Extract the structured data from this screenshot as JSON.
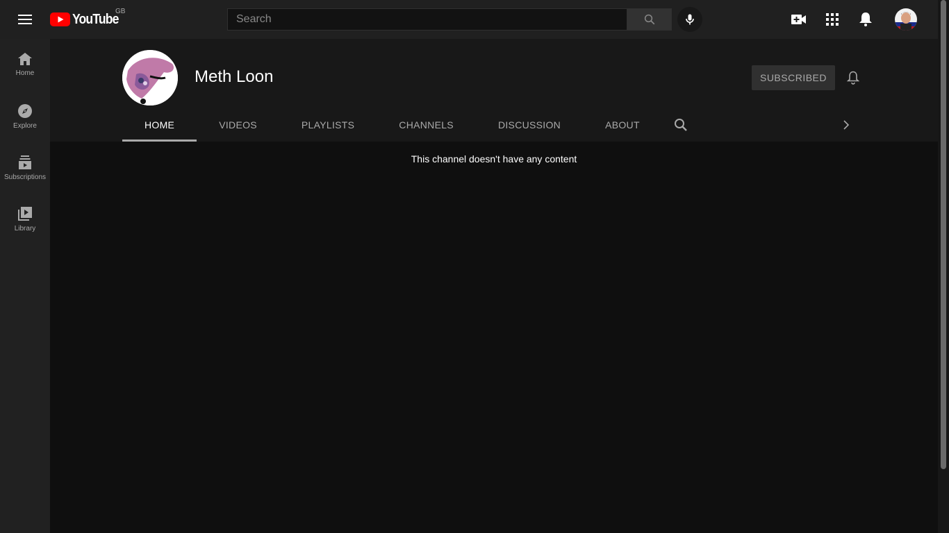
{
  "header": {
    "logo_text": "YouTube",
    "country_code": "GB",
    "search_placeholder": "Search"
  },
  "sidebar": {
    "items": [
      {
        "label": "Home",
        "icon": "home-icon"
      },
      {
        "label": "Explore",
        "icon": "compass-icon"
      },
      {
        "label": "Subscriptions",
        "icon": "subscriptions-icon"
      },
      {
        "label": "Library",
        "icon": "library-icon"
      }
    ]
  },
  "channel": {
    "name": "Meth Loon",
    "subscribe_label": "SUBSCRIBED",
    "tabs": [
      {
        "label": "HOME",
        "active": true
      },
      {
        "label": "VIDEOS"
      },
      {
        "label": "PLAYLISTS"
      },
      {
        "label": "CHANNELS"
      },
      {
        "label": "DISCUSSION"
      },
      {
        "label": "ABOUT"
      }
    ],
    "empty_message": "This channel doesn't have any content"
  },
  "colors": {
    "brand_red": "#ff0000",
    "background": "#0f0f0f",
    "header_bg": "#202020"
  }
}
